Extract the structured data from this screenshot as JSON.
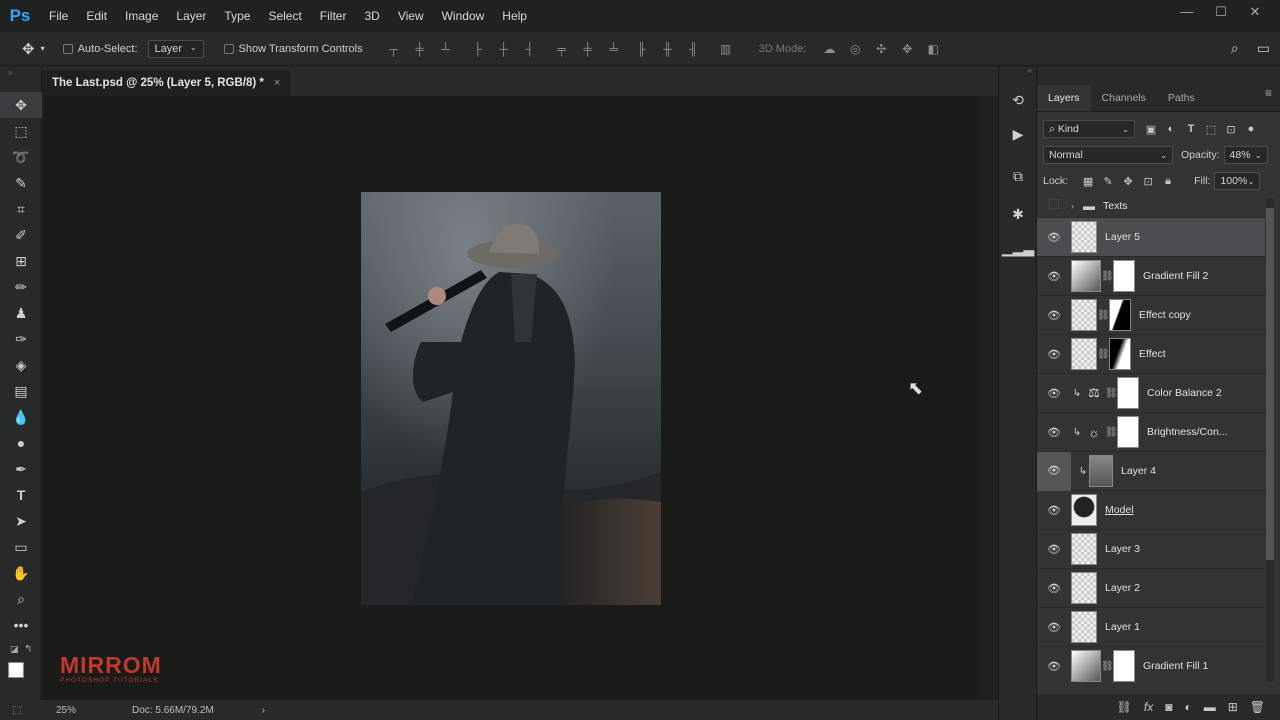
{
  "app": {
    "logo": "Ps"
  },
  "menu": [
    "File",
    "Edit",
    "Image",
    "Layer",
    "Type",
    "Select",
    "Filter",
    "3D",
    "View",
    "Window",
    "Help"
  ],
  "options": {
    "auto_select_label": "Auto-Select:",
    "auto_select_value": "Layer",
    "show_transform_label": "Show Transform Controls",
    "mode_3d": "3D Mode:"
  },
  "document": {
    "tab_title": "The Last.psd @ 25% (Layer 5, RGB/8) *",
    "tab_close": "×"
  },
  "status": {
    "zoom": "25%",
    "doc": "Doc: 5.66M/79.2M",
    "arrow": "›"
  },
  "layers_panel": {
    "tabs": [
      "Layers",
      "Channels",
      "Paths"
    ],
    "filter_value": "Kind",
    "blend_mode": "Normal",
    "opacity_label": "Opacity:",
    "opacity_value": "48%",
    "lock_label": "Lock:",
    "fill_label": "Fill:",
    "fill_value": "100%",
    "layers": [
      {
        "name": "Texts"
      },
      {
        "name": "Layer 5"
      },
      {
        "name": "Gradient Fill 2"
      },
      {
        "name": "Effect copy"
      },
      {
        "name": "Effect"
      },
      {
        "name": "Color Balance 2"
      },
      {
        "name": "Brightness/Con..."
      },
      {
        "name": "Layer 4"
      },
      {
        "name": "Model"
      },
      {
        "name": "Layer 3"
      },
      {
        "name": "Layer 2"
      },
      {
        "name": "Layer 1"
      },
      {
        "name": "Gradient Fill 1"
      }
    ]
  },
  "watermark": {
    "main": "MIRROM",
    "sub": "PHOTOSHOP TUTORIALS"
  }
}
